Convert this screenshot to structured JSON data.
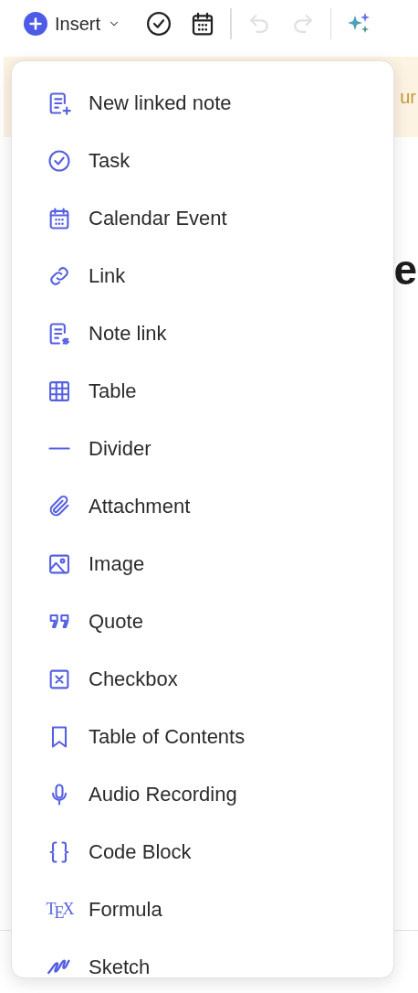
{
  "toolbar": {
    "insert_label": "Insert",
    "buttons": [
      {
        "kind": "task",
        "disabled": false
      },
      {
        "kind": "calendar",
        "disabled": false
      },
      {
        "kind": "undo",
        "disabled": true
      },
      {
        "kind": "redo",
        "disabled": true
      },
      {
        "kind": "ai",
        "disabled": false
      }
    ]
  },
  "banner": {
    "text": "ur"
  },
  "heading": {
    "text": "e"
  },
  "menu": {
    "items": [
      {
        "kind": "linked-note",
        "label": "New linked note"
      },
      {
        "kind": "task",
        "label": "Task"
      },
      {
        "kind": "calendar",
        "label": "Calendar Event"
      },
      {
        "kind": "link",
        "label": "Link"
      },
      {
        "kind": "note-link",
        "label": "Note link"
      },
      {
        "kind": "table",
        "label": "Table"
      },
      {
        "kind": "divider",
        "label": "Divider"
      },
      {
        "kind": "attachment",
        "label": "Attachment"
      },
      {
        "kind": "image",
        "label": "Image"
      },
      {
        "kind": "quote",
        "label": "Quote"
      },
      {
        "kind": "checkbox",
        "label": "Checkbox"
      },
      {
        "kind": "toc",
        "label": "Table of Contents"
      },
      {
        "kind": "audio",
        "label": "Audio Recording"
      },
      {
        "kind": "code",
        "label": "Code Block"
      },
      {
        "kind": "formula",
        "label": "Formula",
        "glyph": "TEX"
      },
      {
        "kind": "sketch",
        "label": "Sketch"
      }
    ]
  }
}
